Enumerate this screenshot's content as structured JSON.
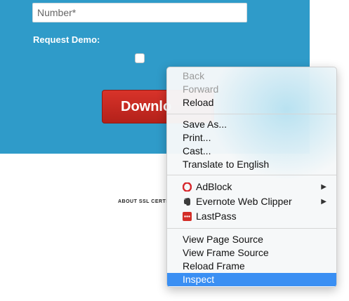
{
  "form": {
    "number_placeholder": "Number*",
    "request_demo_label": "Request Demo:",
    "download_label": "Downlo"
  },
  "footer": {
    "link_text": "ABOUT SSL CERTI"
  },
  "context_menu": {
    "back": "Back",
    "forward": "Forward",
    "reload": "Reload",
    "save_as": "Save As...",
    "print": "Print...",
    "cast": "Cast...",
    "translate": "Translate to English",
    "adblock": "AdBlock",
    "evernote": "Evernote Web Clipper",
    "lastpass": "LastPass",
    "view_page_source": "View Page Source",
    "view_frame_source": "View Frame Source",
    "reload_frame": "Reload Frame",
    "inspect": "Inspect"
  },
  "colors": {
    "panel_blue": "#2f9bc9",
    "download_red": "#c62a22",
    "menu_highlight": "#3a8ff3",
    "adblock_red": "#d7262b",
    "lastpass_red": "#d32d27",
    "evernote_dark": "#3b3b3b"
  },
  "icons": {
    "adblock": "opera-adblock-icon",
    "evernote": "evernote-elephant-icon",
    "lastpass": "lastpass-icon",
    "submenu": "triangle-right-icon"
  }
}
